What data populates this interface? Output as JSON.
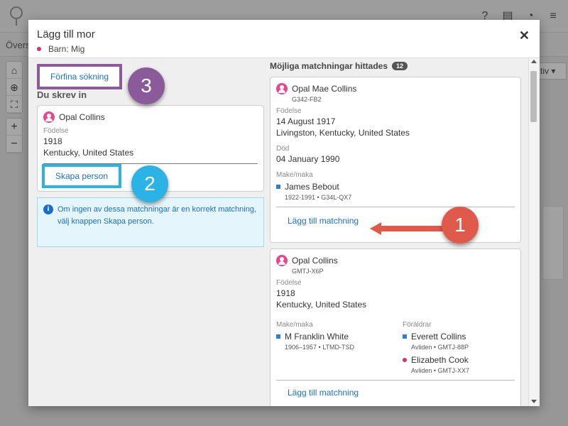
{
  "background": {
    "subbar_text": "Övers",
    "dropdown_text": "tiv ▾"
  },
  "modal": {
    "title": "Lägg till mor",
    "subtitle": "Barn: Mig",
    "close_glyph": "✕"
  },
  "left": {
    "refine_button": "Förfina sökning",
    "you_typed_heading": "Du skrev in",
    "entered": {
      "name": "Opal Collins",
      "birth_label": "Födelse",
      "birth_year": "1918",
      "birth_place": "Kentucky, United States"
    },
    "create_button": "Skapa person",
    "info_text": "Om ingen av dessa matchningar är en korrekt matchning, välj knappen Skapa person."
  },
  "right": {
    "matches_heading": "Möjliga matchningar hittades",
    "matches_count": "12",
    "matches": [
      {
        "name": "Opal Mae Collins",
        "id": "G342-FB2",
        "birth_label": "Födelse",
        "birth_date": "14 August 1917",
        "birth_place": "Livingston, Kentucky, United States",
        "death_label": "Död",
        "death_date": "04 January 1990",
        "spouse_label": "Make/maka",
        "spouse_name": "James Bebout",
        "spouse_details": "1922-1991 • G34L-QX7",
        "add_link": "Lägg till matchning"
      },
      {
        "name": "Opal Collins",
        "id": "GMTJ-X6P",
        "birth_label": "Födelse",
        "birth_year": "1918",
        "birth_place": "Kentucky, United States",
        "spouse_label": "Make/maka",
        "spouse_name": "M Franklin White",
        "spouse_details": "1906–1957 • LTMD-TSD",
        "parents_label": "Föräldrar",
        "father_name": "Everett Collins",
        "father_details": "Avliden • GMTJ-88P",
        "mother_name": "Elizabeth Cook",
        "mother_details": "Avliden • GMTJ-XX7",
        "add_link": "Lägg till matchning"
      }
    ]
  },
  "annotations": {
    "callout_1": "1",
    "callout_2": "2",
    "callout_3": "3"
  },
  "colors": {
    "callout_1": "#e05a4b",
    "callout_2": "#2bb3e6",
    "callout_3": "#8a5a9a",
    "link": "#1a6fc2",
    "female": "#e8458b"
  }
}
